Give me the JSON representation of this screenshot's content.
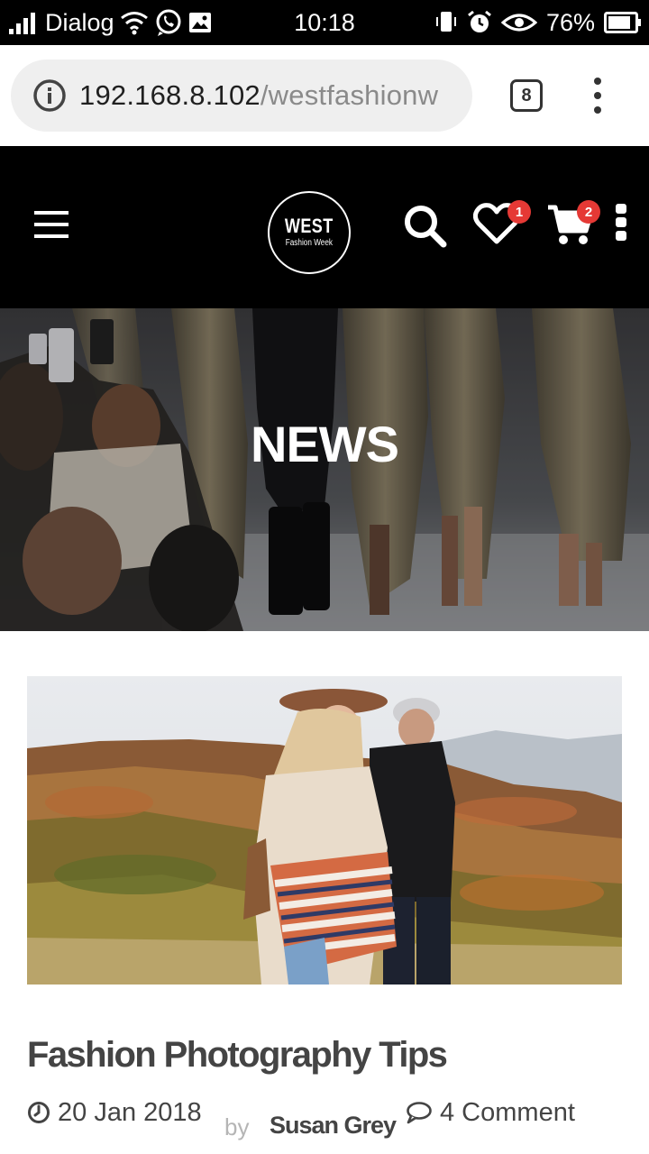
{
  "status_bar": {
    "carrier": "Dialog",
    "time": "10:18",
    "battery": "76%",
    "icons": [
      "signal-icon",
      "wifi-icon",
      "whatsapp-icon",
      "image-icon",
      "vibrate-icon",
      "alarm-icon",
      "eye-icon",
      "battery-icon"
    ]
  },
  "browser": {
    "url_host": "192.168.8.102",
    "url_path": "/westfashionw",
    "tab_count": "8",
    "icons": [
      "info-icon",
      "tab-switcher-icon",
      "more-vert-icon"
    ]
  },
  "site_header": {
    "logo_title": "WEST",
    "logo_subtitle": "Fashion Week",
    "wishlist_count": "1",
    "cart_count": "2",
    "badge_color": "#e53935",
    "icons": [
      "hamburger-icon",
      "search-icon",
      "heart-icon",
      "cart-icon",
      "more-vert-icon"
    ]
  },
  "hero": {
    "title": "NEWS"
  },
  "post": {
    "title": "Fashion Photography Tips",
    "date": "20 Jan 2018",
    "by_label": "by",
    "author": "Susan Grey",
    "comments": "4 Comment",
    "icons": [
      "clock-icon",
      "comment-icon"
    ]
  }
}
